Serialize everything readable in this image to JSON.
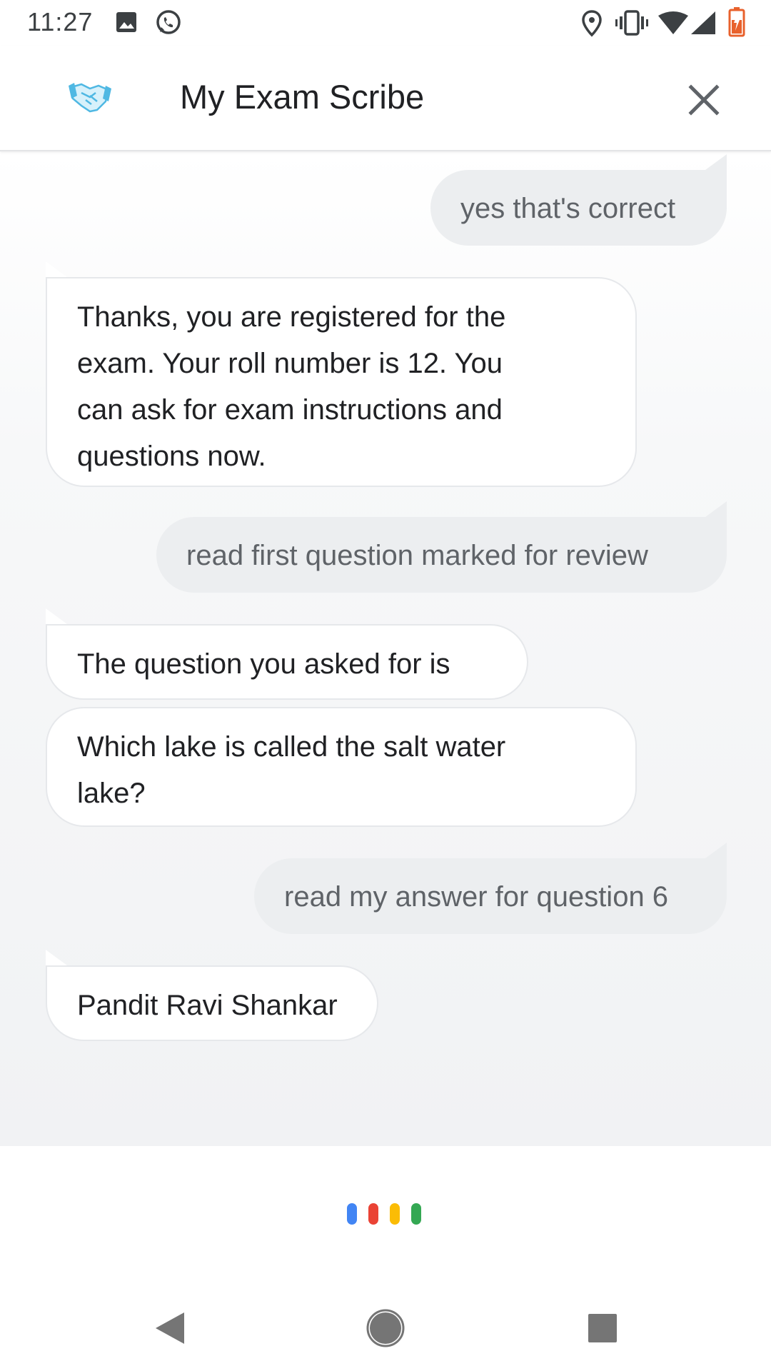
{
  "status_bar": {
    "time": "11:27",
    "icons": [
      "image-icon",
      "whatsapp-icon",
      "location-icon",
      "vibrate-icon",
      "wifi-icon",
      "signal-icon",
      "battery-icon"
    ],
    "battery_color": "#e8612c"
  },
  "header": {
    "title": "My Exam Scribe",
    "logo_icon": "handshake-icon",
    "close_icon": "close-icon"
  },
  "messages": [
    {
      "sender": "user",
      "text": "yes that's correct"
    },
    {
      "sender": "bot",
      "lines": [
        "Thanks, you are registered for the",
        "exam. Your roll number is 12. You",
        "can ask for exam instructions and",
        "questions now."
      ]
    },
    {
      "sender": "user",
      "text": "read first question marked for review"
    },
    {
      "sender": "bot",
      "text": "The question you asked for is"
    },
    {
      "sender": "bot",
      "lines": [
        "Which lake is called the salt water",
        "lake?"
      ]
    },
    {
      "sender": "user",
      "text": "read my answer for question 6"
    },
    {
      "sender": "bot",
      "text": "Pandit Ravi Shankar"
    }
  ],
  "assistant": {
    "indicator_colors": [
      "#4285f4",
      "#ea4335",
      "#fbbc05",
      "#34a853"
    ]
  },
  "nav_bar": {
    "buttons": [
      "back-icon",
      "home-icon",
      "recents-icon"
    ]
  }
}
